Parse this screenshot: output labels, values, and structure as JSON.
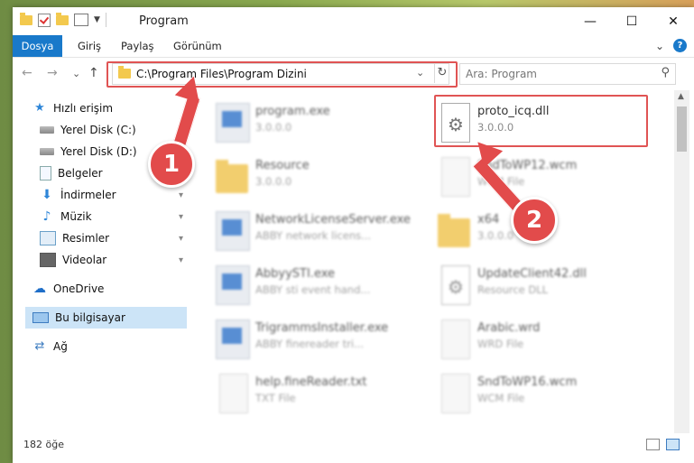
{
  "window": {
    "title": "Program",
    "controls": {
      "minimize": "—",
      "maximize": "☐",
      "close": "✕"
    }
  },
  "ribbon": {
    "tabs": [
      "Dosya",
      "Giriş",
      "Paylaş",
      "Görünüm"
    ],
    "expand": "⌄",
    "help": "?"
  },
  "navigation": {
    "back": "←",
    "forward": "→",
    "recent": "⌄",
    "up": "↑",
    "address": "C:\\Program Files\\Program Dizini",
    "address_dropdown": "⌄",
    "refresh": "↻",
    "search_placeholder": "Ara: Program",
    "search_icon": "⚲"
  },
  "sidebar": {
    "items": [
      {
        "label": "Hızlı erişim",
        "icon": "star-icon",
        "glyph": "★"
      },
      {
        "label": "Yerel Disk (C:)",
        "icon": "drive-icon",
        "glyph": ""
      },
      {
        "label": "Yerel Disk (D:)",
        "icon": "drive-icon",
        "glyph": ""
      },
      {
        "label": "Belgeler",
        "icon": "document-icon",
        "glyph": ""
      },
      {
        "label": "İndirmeler",
        "icon": "download-icon",
        "glyph": "⬇"
      },
      {
        "label": "Müzik",
        "icon": "music-icon",
        "glyph": "♪"
      },
      {
        "label": "Resimler",
        "icon": "picture-icon",
        "glyph": ""
      },
      {
        "label": "Videolar",
        "icon": "video-icon",
        "glyph": ""
      },
      {
        "label": "OneDrive",
        "icon": "cloud-icon",
        "glyph": "☁"
      },
      {
        "label": "Bu bilgisayar",
        "icon": "computer-icon",
        "glyph": ""
      },
      {
        "label": "Ağ",
        "icon": "network-icon",
        "glyph": "⇄"
      }
    ],
    "pin_glyph": "📌"
  },
  "files": [
    {
      "name": "program.exe",
      "sub": "3.0.0.0",
      "type": "exe"
    },
    {
      "name": "proto_icq.dll",
      "sub": "3.0.0.0",
      "type": "dll"
    },
    {
      "name": "Resource",
      "sub": "3.0.0.0",
      "type": "folder"
    },
    {
      "name": "SndToWP12.wcm",
      "sub": "WCM File",
      "type": "doc"
    },
    {
      "name": "NetworkLicenseServer.exe",
      "sub": "ABBY network licens...",
      "type": "exe"
    },
    {
      "name": "x64",
      "sub": "3.0.0.0",
      "type": "folder"
    },
    {
      "name": "AbbyySTI.exe",
      "sub": "ABBY sti event hand...",
      "type": "exe"
    },
    {
      "name": "UpdateClient42.dll",
      "sub": "Resource DLL",
      "type": "dll"
    },
    {
      "name": "TrigrammsInstaller.exe",
      "sub": "ABBY finereader tri...",
      "type": "exe"
    },
    {
      "name": "Arabic.wrd",
      "sub": "WRD File",
      "type": "doc"
    },
    {
      "name": "help.fineReader.txt",
      "sub": "TXT File",
      "type": "doc"
    },
    {
      "name": "SndToWP16.wcm",
      "sub": "WCM File",
      "type": "doc"
    }
  ],
  "status": {
    "count": "182 öğe"
  },
  "callouts": {
    "one": "1",
    "two": "2"
  },
  "colors": {
    "accent": "#1979ca",
    "highlight": "#e05454",
    "selected": "#cce4f7"
  }
}
